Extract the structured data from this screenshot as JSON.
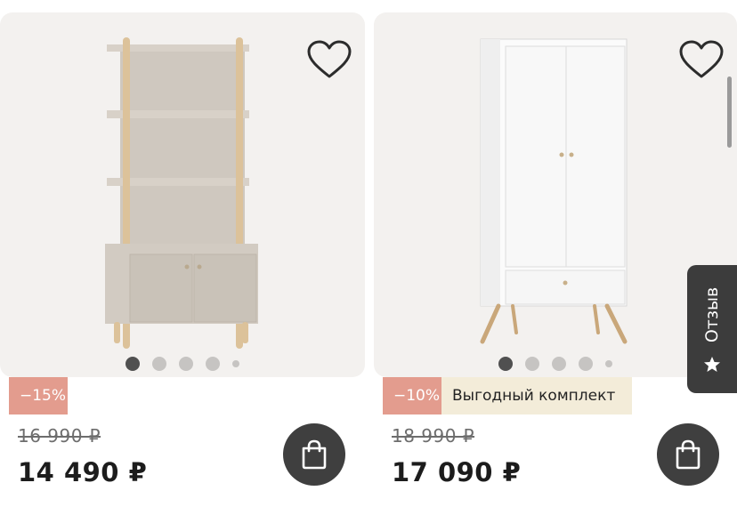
{
  "products": [
    {
      "image_name": "shelving-cabinet",
      "favorite_icon": "heart-outline-icon",
      "gallery_dots": 5,
      "gallery_active": 1,
      "badges": [
        {
          "text": "−15%",
          "color": "#e39c8e"
        }
      ],
      "old_price": "16 990 ₽",
      "price": "14 490 ₽",
      "cart_icon": "shopping-bag-icon"
    },
    {
      "image_name": "white-wardrobe",
      "favorite_icon": "heart-outline-icon",
      "gallery_dots": 5,
      "gallery_active": 1,
      "badges": [
        {
          "text": "−10%",
          "color": "#e39c8e"
        },
        {
          "text": "Выгодный комплект",
          "color": "#f3ecd9"
        }
      ],
      "old_price": "18 990 ₽",
      "price": "17 090 ₽",
      "cart_icon": "shopping-bag-icon"
    }
  ],
  "review_tab": {
    "label": "Отзыв",
    "icon": "star-icon"
  },
  "colors": {
    "card_bg": "#f3f1ef",
    "cart_button": "#3f3f3f",
    "review_tab": "#3c3c3c"
  }
}
